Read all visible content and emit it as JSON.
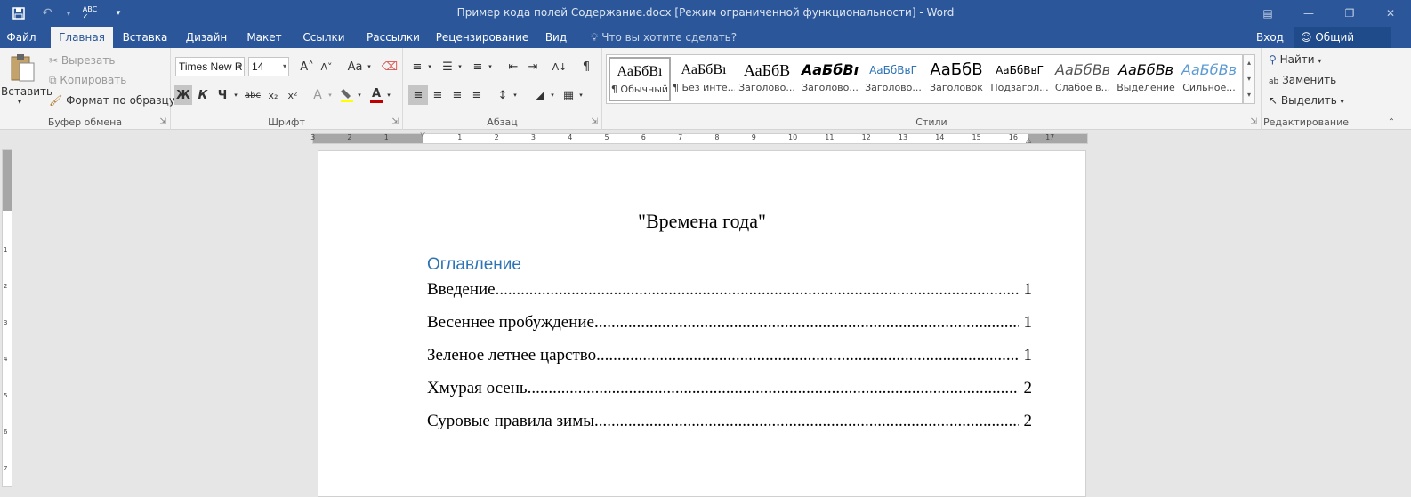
{
  "window": {
    "title": "Пример кода полей Содержание.docx [Режим ограниченной функциональности] - Word"
  },
  "tabs": [
    "Файл",
    "Главная",
    "Вставка",
    "Дизайн",
    "Макет",
    "Ссылки",
    "Рассылки",
    "Рецензирование",
    "Вид"
  ],
  "tell_me": "Что вы хотите сделать?",
  "signin": "Вход",
  "share": "Общий доступ",
  "clipboard": {
    "paste": "Вставить",
    "cut": "Вырезать",
    "copy": "Копировать",
    "format_painter": "Формат по образцу",
    "label": "Буфер обмена"
  },
  "font": {
    "name": "Times New R",
    "size": "14",
    "label": "Шрифт",
    "bold": "Ж",
    "italic": "К",
    "underline": "Ч",
    "strike": "abc",
    "sub": "x₂",
    "sup": "x²",
    "grow": "A˄",
    "shrink": "A˅",
    "case": "Aa",
    "effects": "A",
    "color": "A"
  },
  "paragraph": {
    "label": "Абзац"
  },
  "styles": {
    "label": "Стили",
    "items": [
      {
        "preview": "АаБбВı",
        "name": "¶ Обычный"
      },
      {
        "preview": "АаБбВı",
        "name": "¶ Без инте..."
      },
      {
        "preview": "АаБбВ",
        "name": "Заголово..."
      },
      {
        "preview": "АаБбВı",
        "name": "Заголово..."
      },
      {
        "preview": "АаБбВвГ",
        "name": "Заголово..."
      },
      {
        "preview": "АаБбВ",
        "name": "Заголовок"
      },
      {
        "preview": "АаБбВвГ",
        "name": "Подзагол..."
      },
      {
        "preview": "АаБбВв",
        "name": "Слабое в..."
      },
      {
        "preview": "АаБбВв",
        "name": "Выделение"
      },
      {
        "preview": "АаБбВв",
        "name": "Сильное..."
      }
    ]
  },
  "editing": {
    "find": "Найти",
    "replace": "Заменить",
    "select": "Выделить",
    "label": "Редактирование"
  },
  "ruler": {
    "ticks": [
      "3",
      "2",
      "1",
      "1",
      "2",
      "3",
      "4",
      "5",
      "6",
      "7",
      "8",
      "9",
      "10",
      "11",
      "12",
      "13",
      "14",
      "15",
      "16",
      "17"
    ],
    "vticks": [
      "1",
      "2",
      "3",
      "4",
      "5",
      "6",
      "7"
    ]
  },
  "document": {
    "title": "\"Времена года\"",
    "toc_heading": "Оглавление",
    "toc": [
      {
        "label": "Введение",
        "page": "1"
      },
      {
        "label": "Весеннее пробуждение ",
        "page": "1"
      },
      {
        "label": "Зеленое летнее царство ",
        "page": "1"
      },
      {
        "label": "Хмурая осень",
        "page": "2"
      },
      {
        "label": "Суровые правила зимы ",
        "page": "2"
      }
    ]
  },
  "colors": {
    "brand": "#2b579a",
    "heading": "#2e74b5",
    "highlight": "#ffff00",
    "font_color": "#c00000"
  }
}
